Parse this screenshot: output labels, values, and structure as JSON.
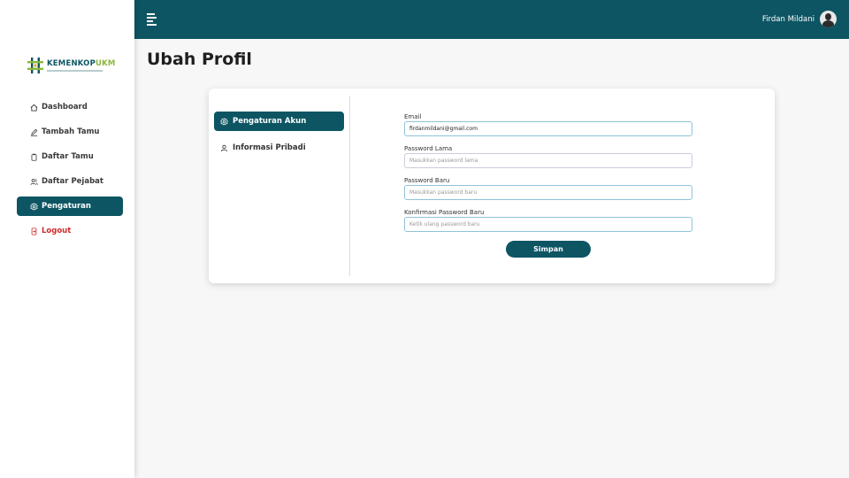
{
  "app": {
    "logo_name_part1": "KEMENKOP",
    "logo_name_part2": "UKM",
    "accent": "#0d5563",
    "logout_color": "#d02a2a"
  },
  "sidebar": {
    "items": [
      {
        "label": "Dashboard",
        "icon": "home-icon",
        "active": false
      },
      {
        "label": "Tambah Tamu",
        "icon": "pencil-icon",
        "active": false
      },
      {
        "label": "Daftar Tamu",
        "icon": "clipboard-icon",
        "active": false
      },
      {
        "label": "Daftar Pejabat",
        "icon": "users-icon",
        "active": false
      },
      {
        "label": "Pengaturan",
        "icon": "gear-icon",
        "active": true
      },
      {
        "label": "Logout",
        "icon": "logout-icon",
        "active": false
      }
    ]
  },
  "topbar": {
    "user_name": "Firdan Mildani"
  },
  "page": {
    "title": "Ubah Profil"
  },
  "tabs": [
    {
      "label": "Pengaturan Akun",
      "icon": "gear-icon",
      "active": true
    },
    {
      "label": "Informasi Pribadi",
      "icon": "user-icon",
      "active": false
    }
  ],
  "form": {
    "email_label": "Email",
    "email_value": "firdanmildani@gmail.com",
    "old_password_label": "Password Lama",
    "old_password_placeholder": "Masukkan password lama",
    "new_password_label": "Password Baru",
    "new_password_placeholder": "Masukkan password baru",
    "confirm_password_label": "Konfirmasi Password Baru",
    "confirm_password_placeholder": "Ketik ulang password baru",
    "submit_label": "Simpan"
  }
}
